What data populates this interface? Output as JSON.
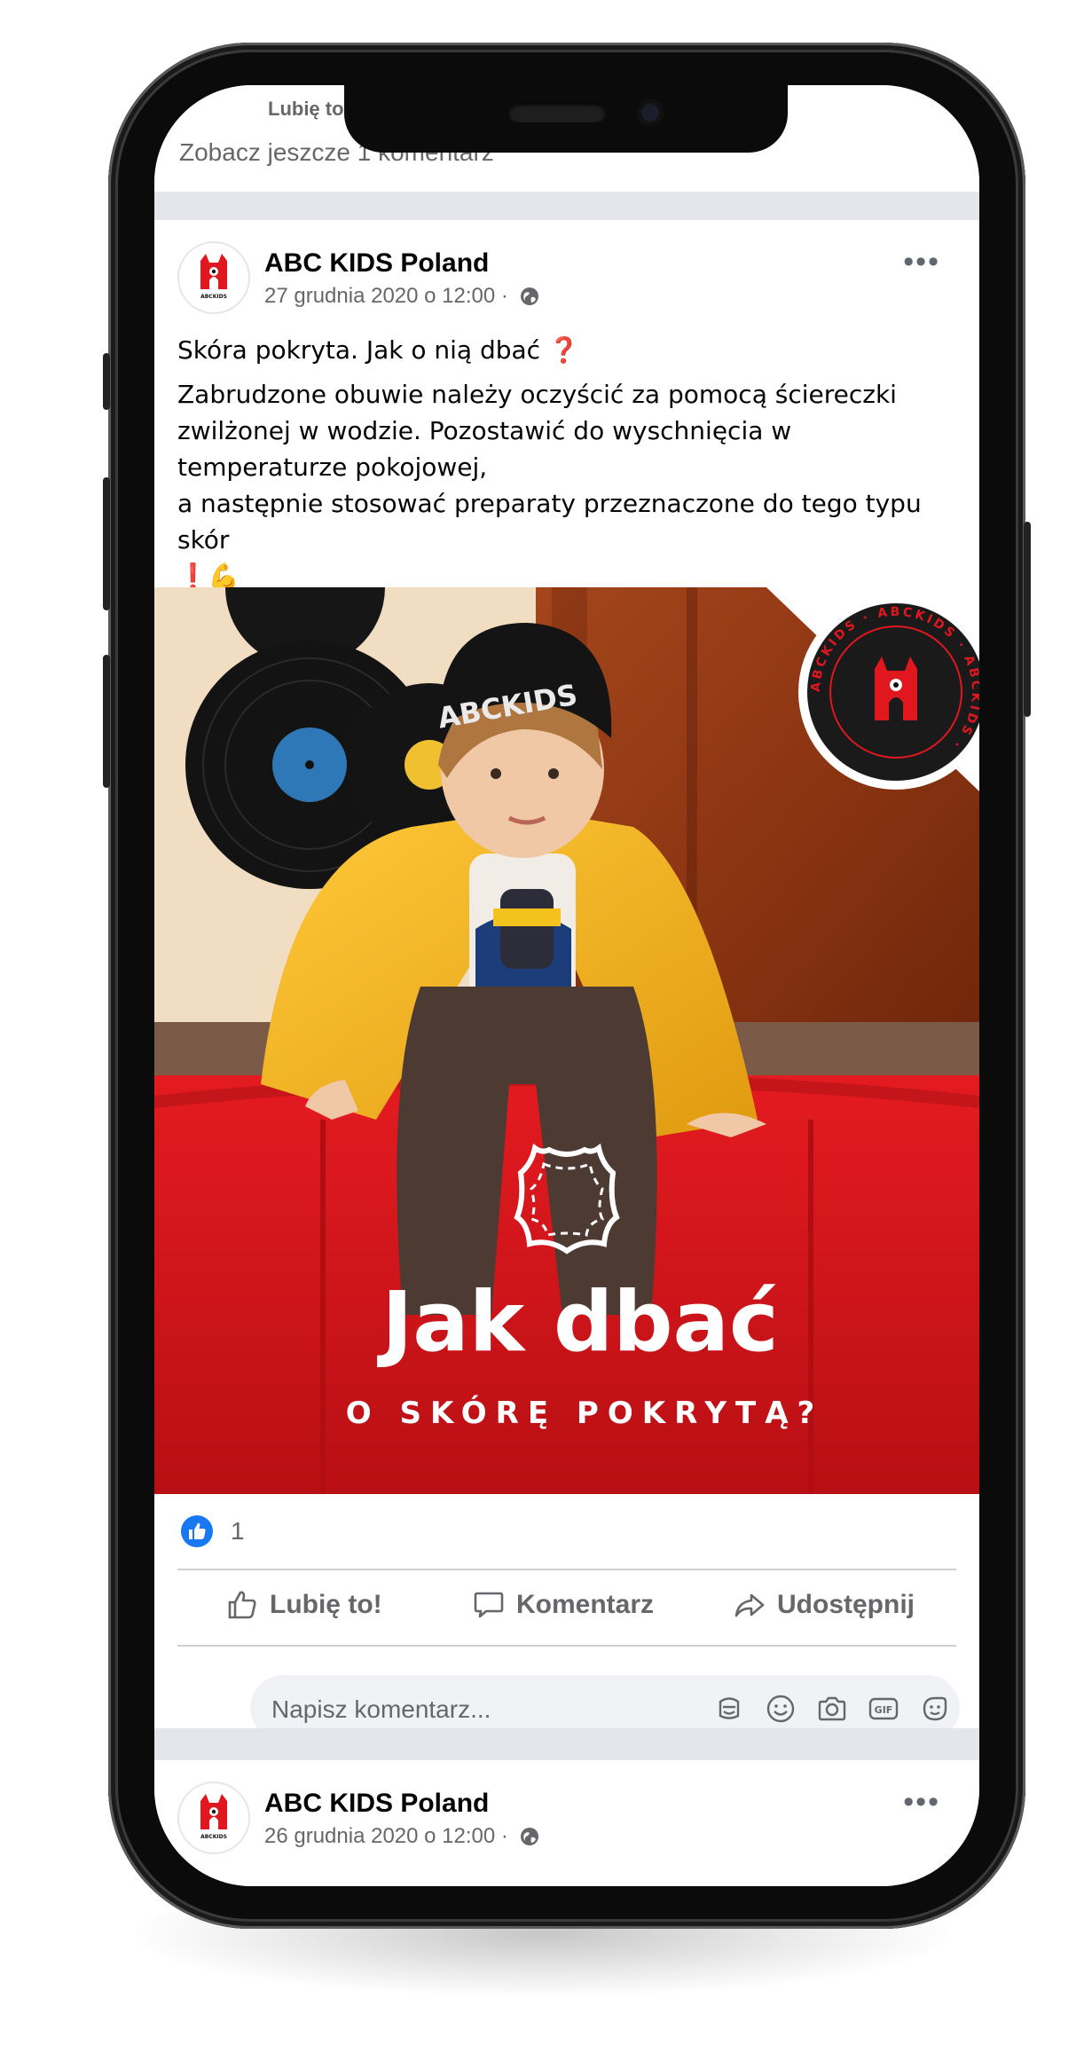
{
  "top_card": {
    "like_label": "Lubię to",
    "see_more": "Zobacz jeszcze 1 komentarz"
  },
  "post": {
    "author": "ABC KIDS Poland",
    "date": "27 grudnia 2020 o 12:00 ·",
    "title": "Skóra pokryta. Jak o nią dbać ❓",
    "body": "Zabrudzone obuwie należy oczyścić za pomocą ściereczki zwilżonej w wodzie. Pozostawić do wyschnięcia w temperaturze pokojowej,\na następnie stosować preparaty przeznaczone do tego typu skór\n❗💪",
    "image": {
      "headline": "Jak dbać",
      "subline": "O SKÓRĘ POKRYTĄ?",
      "cap_text": "ABCKIDS",
      "badge_text": "ABCKIDS · ABCKIDS · ABCKIDS ·"
    },
    "like_count": "1",
    "actions": {
      "like": "Lubię to!",
      "comment": "Komentarz",
      "share": "Udostępnij"
    },
    "comment_placeholder": "Napisz komentarz..."
  },
  "next_post": {
    "author": "ABC KIDS Poland",
    "date": "26 grudnia 2020 o 12:00 ·"
  },
  "avatar_text": "ABCKIDS",
  "colors": {
    "facebook_blue": "#1877f2",
    "brand_red": "#e0171f",
    "jacket_yellow": "#f2b01e"
  }
}
